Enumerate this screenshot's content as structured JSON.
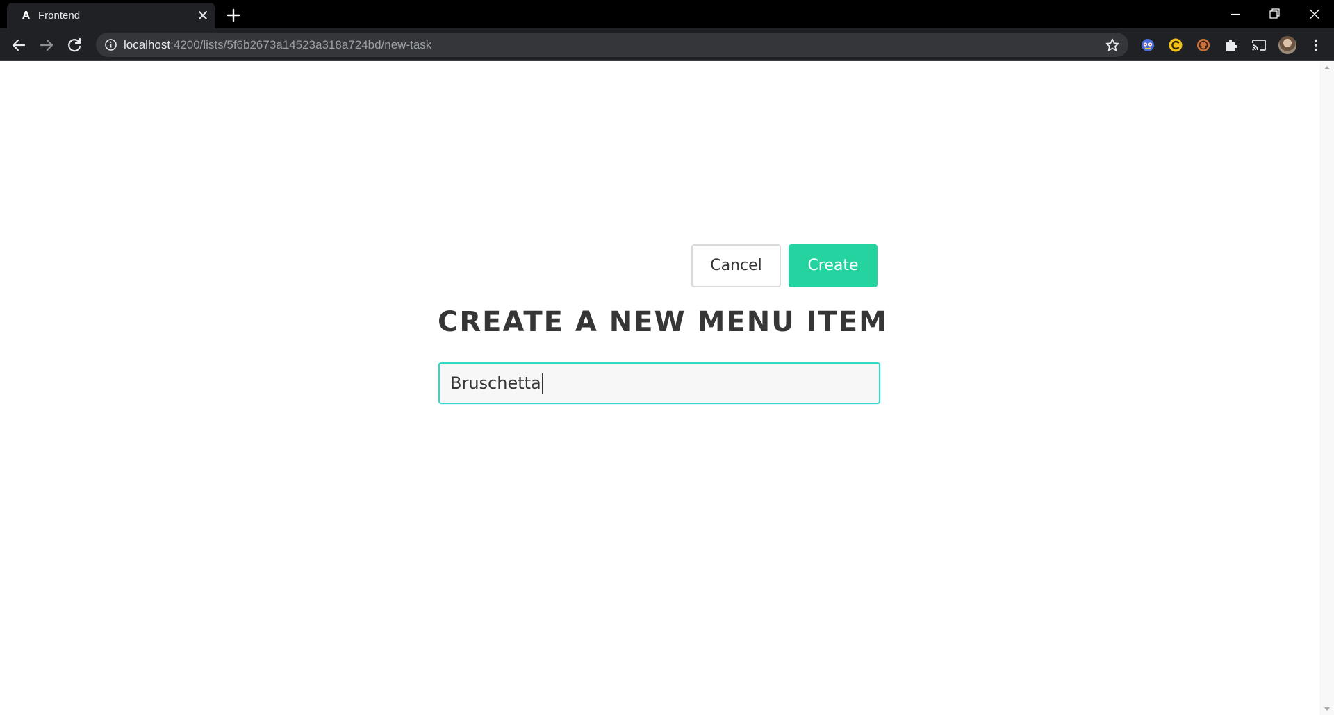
{
  "browser": {
    "tab": {
      "favicon_glyph": "A",
      "title": "Frontend"
    },
    "url": {
      "host": "localhost",
      "rest": ":4200/lists/5f6b2673a14523a318a724bd/new-task"
    }
  },
  "page": {
    "heading": "CREATE A NEW MENU ITEM",
    "input_value": "Bruschetta",
    "cancel_label": "Cancel",
    "create_label": "Create"
  },
  "colors": {
    "accent": "#24d3a0",
    "focus_border": "#2fd9c6",
    "heading": "#363636"
  }
}
